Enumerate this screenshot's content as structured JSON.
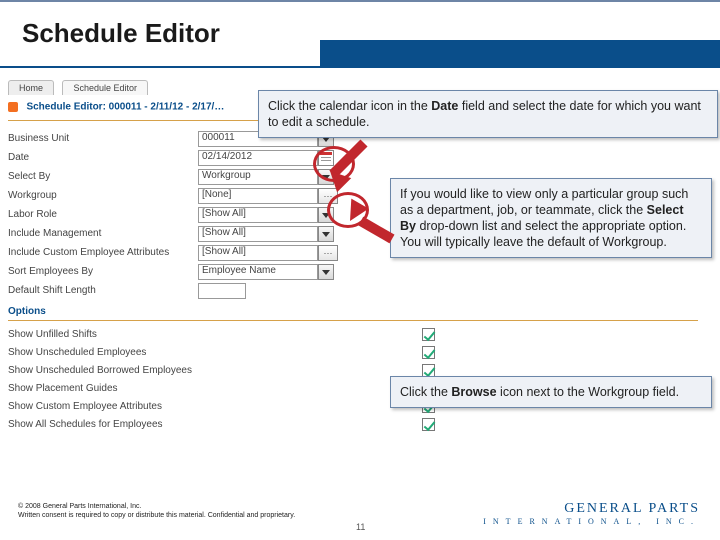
{
  "title": "Schedule Editor",
  "tabs": {
    "home": "Home",
    "current": "Schedule Editor"
  },
  "header": "Schedule Editor: 000011 - 2/11/12 - 2/17/…",
  "form": {
    "business_unit": {
      "label": "Business Unit",
      "value": "000011"
    },
    "date": {
      "label": "Date",
      "value": "02/14/2012"
    },
    "select_by": {
      "label": "Select By",
      "value": "Workgroup"
    },
    "workgroup": {
      "label": "Workgroup",
      "value": "[None]"
    },
    "labor_role": {
      "label": "Labor Role",
      "value": "[Show All]"
    },
    "inc_mgmt": {
      "label": "Include Management",
      "value": "[Show All]"
    },
    "inc_attr": {
      "label": "Include Custom Employee Attributes",
      "value": "[Show All]"
    },
    "sort_by": {
      "label": "Sort Employees By",
      "value": "Employee Name"
    },
    "shift_len": {
      "label": "Default Shift Length",
      "value": ""
    }
  },
  "options_header": "Options",
  "options": [
    {
      "label": "Show Unfilled Shifts",
      "checked": true
    },
    {
      "label": "Show Unscheduled Employees",
      "checked": true
    },
    {
      "label": "Show Unscheduled Borrowed Employees",
      "checked": true
    },
    {
      "label": "Show Placement Guides",
      "checked": true
    },
    {
      "label": "Show Custom Employee Attributes",
      "checked": true
    },
    {
      "label": "Show All Schedules for Employees",
      "checked": true
    }
  ],
  "browse_glyph": "···",
  "callouts": {
    "c1_a": "Click the calendar icon in the ",
    "c1_b": "Date",
    "c1_c": " field and select the date for which you want to edit a schedule.",
    "c2_a": "If you would like to view only a particular group such as a department, job, or teammate, click the ",
    "c2_b": "Select By",
    "c2_c": " drop-down list and select the appropriate option.  You will typically leave the default of Workgroup.",
    "c3_a": "Click the ",
    "c3_b": "Browse",
    "c3_c": " icon next to the Workgroup field."
  },
  "footer": {
    "copy": "© 2008 General Parts International, Inc.",
    "legal": "Written consent is required to copy or distribute this material. Confidential and proprietary.",
    "brand_top": "GENERAL PARTS",
    "brand_bot": "INTERNATIONAL, INC.",
    "page": "11"
  }
}
